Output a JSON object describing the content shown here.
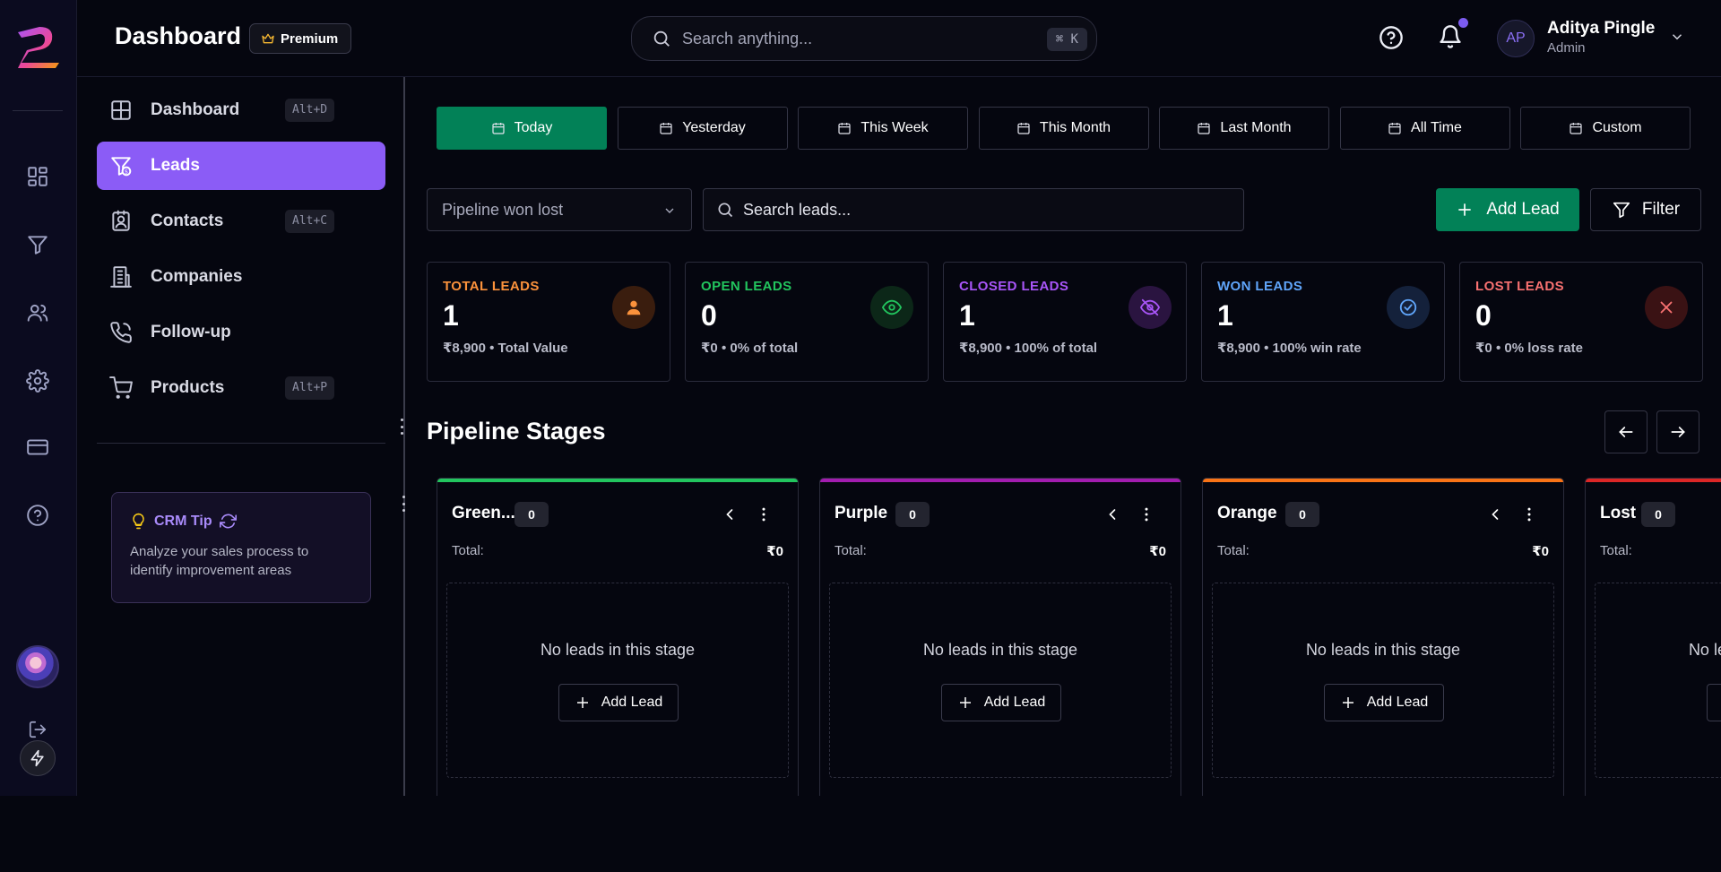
{
  "header": {
    "title": "Dashboard",
    "premium_label": "Premium",
    "search_placeholder": "Search anything...",
    "search_shortcut": "⌘ K",
    "user": {
      "initials": "AP",
      "name": "Aditya Pingle",
      "role": "Admin"
    }
  },
  "rail": {
    "icons": [
      "dashboard-icon",
      "funnel-icon",
      "users-icon",
      "gear-icon",
      "credit-card-icon",
      "help-icon"
    ]
  },
  "sidebar": {
    "items": [
      {
        "label": "Dashboard",
        "shortcut": "Alt+D",
        "icon": "dashboard-icon",
        "active": false
      },
      {
        "label": "Leads",
        "shortcut": "",
        "icon": "leads-funnel-icon",
        "active": true
      },
      {
        "label": "Contacts",
        "shortcut": "Alt+C",
        "icon": "contact-card-icon",
        "active": false
      },
      {
        "label": "Companies",
        "shortcut": "",
        "icon": "building-icon",
        "active": false
      },
      {
        "label": "Follow-up",
        "shortcut": "",
        "icon": "phone-icon",
        "active": false
      },
      {
        "label": "Products",
        "shortcut": "Alt+P",
        "icon": "cart-icon",
        "active": false
      }
    ],
    "tip": {
      "title": "CRM Tip",
      "text": "Analyze your sales process to identify improvement areas"
    }
  },
  "date_filters": {
    "options": [
      "Today",
      "Yesterday",
      "This Week",
      "This Month",
      "Last Month",
      "All Time",
      "Custom"
    ],
    "selected": "Today"
  },
  "toolbar": {
    "pipeline_select": "Pipeline won lost",
    "search_placeholder": "Search leads...",
    "add_lead_label": "Add Lead",
    "filter_label": "Filter"
  },
  "stats": [
    {
      "label": "TOTAL LEADS",
      "value": "1",
      "sub": "₹8,900 • Total Value",
      "color": "#fb923c",
      "icon": "person-icon"
    },
    {
      "label": "OPEN LEADS",
      "value": "0",
      "sub": "₹0 • 0% of total",
      "color": "#22c55e",
      "icon": "eye-icon"
    },
    {
      "label": "CLOSED LEADS",
      "value": "1",
      "sub": "₹8,900 • 100% of total",
      "color": "#a855f7",
      "icon": "eye-off-icon"
    },
    {
      "label": "WON LEADS",
      "value": "1",
      "sub": "₹8,900 • 100% win rate",
      "color": "#60a5fa",
      "icon": "check-badge-icon"
    },
    {
      "label": "LOST LEADS",
      "value": "0",
      "sub": "₹0 • 0% loss rate",
      "color": "#f87171",
      "icon": "close-icon"
    }
  ],
  "pipeline": {
    "title": "Pipeline Stages",
    "stages": [
      {
        "name": "Green...",
        "count": "0",
        "total_label": "Total:",
        "total": "₹0",
        "empty_text": "No leads in this stage",
        "add_label": "Add Lead",
        "color": "#22c55e"
      },
      {
        "name": "Purple",
        "count": "0",
        "total_label": "Total:",
        "total": "₹0",
        "empty_text": "No leads in this stage",
        "add_label": "Add Lead",
        "color": "#a21caf"
      },
      {
        "name": "Orange",
        "count": "0",
        "total_label": "Total:",
        "total": "₹0",
        "empty_text": "No leads in this stage",
        "add_label": "Add Lead",
        "color": "#f97316"
      },
      {
        "name": "Lost",
        "count": "0",
        "total_label": "Total:",
        "total": "",
        "empty_text": "No leads in this stage",
        "add_label": "Add Lead",
        "color": "#dc2626"
      }
    ]
  }
}
